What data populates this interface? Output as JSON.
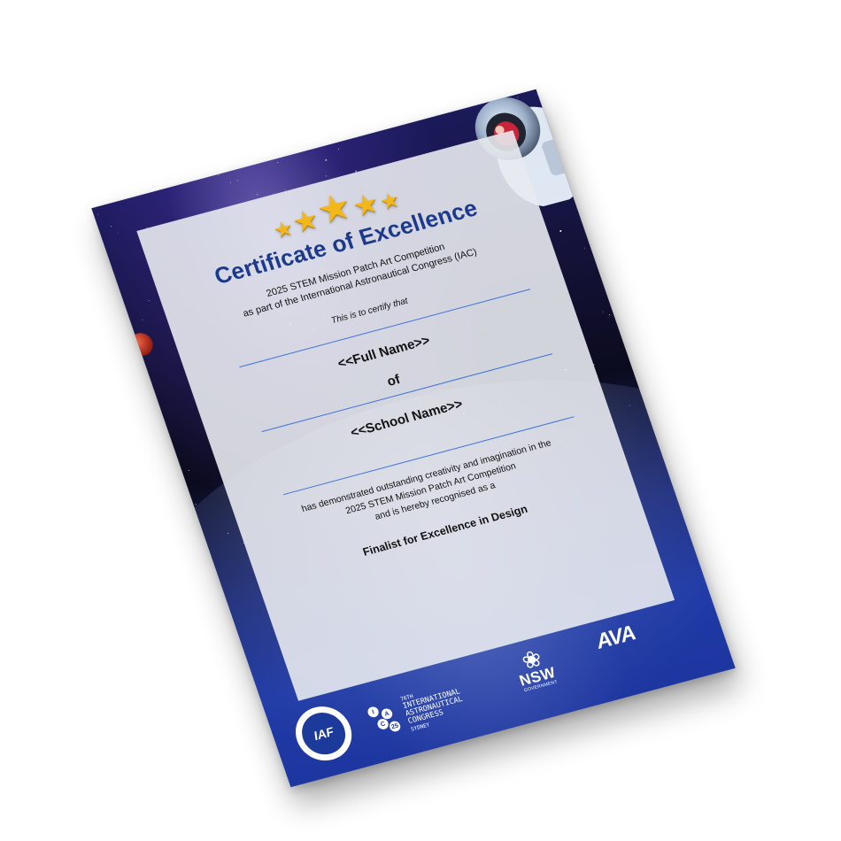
{
  "certificate": {
    "rating_stars": [
      {
        "icon": "star-icon",
        "size": "sm"
      },
      {
        "icon": "star-icon",
        "size": "md"
      },
      {
        "icon": "star-icon",
        "size": "lg"
      },
      {
        "icon": "star-icon",
        "size": "md"
      },
      {
        "icon": "star-icon",
        "size": "sm"
      }
    ],
    "title": "Certificate of Excellence",
    "subtitle_line1": "2025 STEM Mission Patch Art Competition",
    "subtitle_line2": "as part of the International Astronautical Congress (IAC)",
    "certify_text": "This is to certify that",
    "full_name": "<<Full Name>>",
    "of_text": "of",
    "school_name": "<<School Name>>",
    "body_line1": "has demonstrated outstanding creativity and imagination in the",
    "body_line2": "2025 STEM Mission Patch Art Competition",
    "body_line3": "and is hereby recognised as a",
    "award": "Finalist for Excellence in Design"
  },
  "footer_logos": {
    "iaf": {
      "mark": "IAF"
    },
    "iac": {
      "line1": "76TH",
      "line2": "INTERNATIONAL",
      "line3": "ASTRONAUTICAL",
      "line4": "CONGRESS",
      "line5": "SYDNEY",
      "dots": [
        "I",
        "A",
        "C",
        "25"
      ]
    },
    "nsw": {
      "word": "NSW",
      "sub": "GOVERNMENT"
    },
    "ava": {
      "mark": "AVA"
    }
  },
  "colors": {
    "title": "#1c3a8c",
    "rule": "#3f74d9",
    "star": "#f2b81b",
    "band": "#1d36a0"
  }
}
